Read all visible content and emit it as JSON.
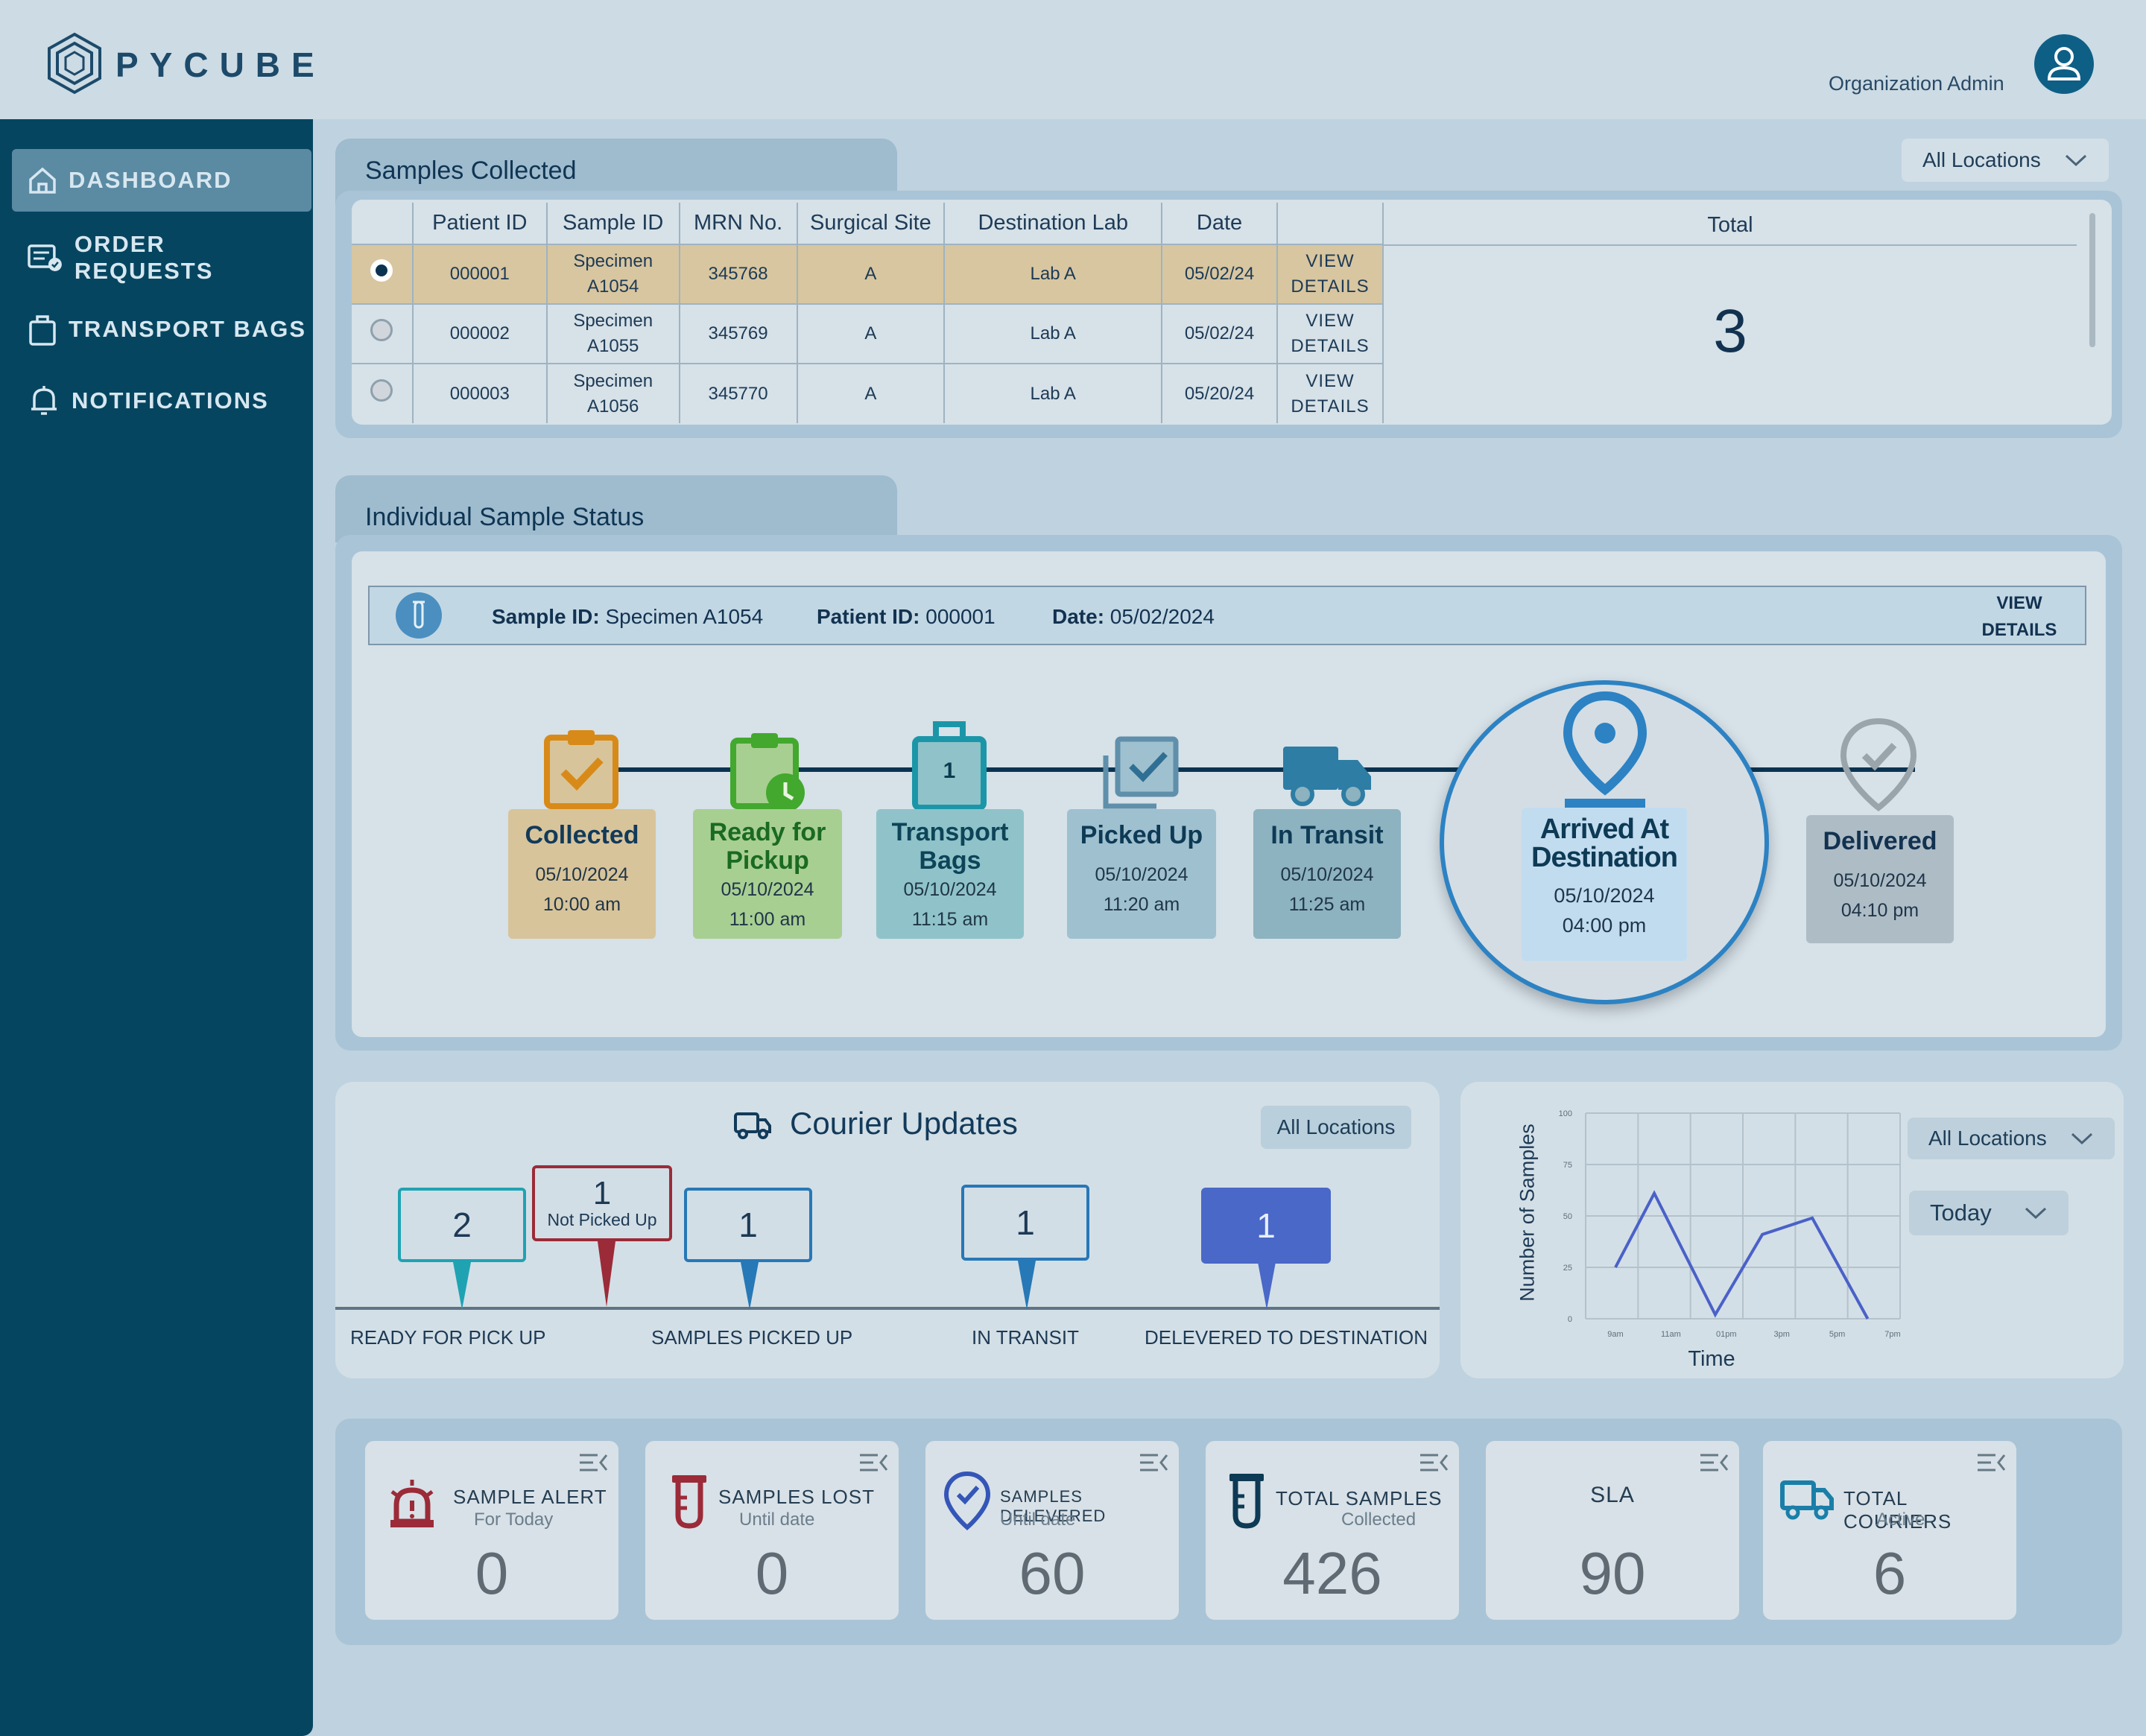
{
  "app": {
    "logo": "PYCUBE",
    "user_role": "Organization Admin"
  },
  "sidebar": {
    "items": [
      {
        "label": "DASHBOARD",
        "icon": "home-icon",
        "active": true
      },
      {
        "label": "ORDER REQUESTS",
        "icon": "order-list-icon",
        "active": false
      },
      {
        "label": "TRANSPORT BAGS",
        "icon": "bag-icon",
        "active": false
      },
      {
        "label": "NOTIFICATIONS",
        "icon": "bell-icon",
        "active": false
      }
    ]
  },
  "samples_collected": {
    "title": "Samples Collected",
    "location_filter": "All Locations",
    "columns": [
      "Patient ID",
      "Sample ID",
      "MRN No.",
      "Surgical Site",
      "Destination Lab",
      "Date"
    ],
    "total_label": "Total",
    "total_value": "3",
    "rows": [
      {
        "patient_id": "000001",
        "sample_line1": "Specimen",
        "sample_line2": "A1054",
        "mrn": "345768",
        "site": "A",
        "lab": "Lab A",
        "date": "05/02/24",
        "action1": "VIEW",
        "action2": "DETAILS",
        "selected": true
      },
      {
        "patient_id": "000002",
        "sample_line1": "Specimen",
        "sample_line2": "A1055",
        "mrn": "345769",
        "site": "A",
        "lab": "Lab A",
        "date": "05/02/24",
        "action1": "VIEW",
        "action2": "DETAILS",
        "selected": false
      },
      {
        "patient_id": "000003",
        "sample_line1": "Specimen",
        "sample_line2": "A1056",
        "mrn": "345770",
        "site": "A",
        "lab": "Lab A",
        "date": "05/20/24",
        "action1": "VIEW",
        "action2": "DETAILS",
        "selected": false
      }
    ]
  },
  "status": {
    "title": "Individual Sample Status",
    "sample_id_label": "Sample ID:",
    "sample_id": "Specimen A1054",
    "patient_id_label": "Patient ID:",
    "patient_id": "000001",
    "date_label": "Date:",
    "date": "05/02/2024",
    "view1": "VIEW",
    "view2": "DETAILS",
    "steps": [
      {
        "l1": "Collected",
        "l2": "",
        "date": "05/10/2024",
        "time": "10:00 am",
        "color": "#d8c49a",
        "icon": "clipboard-check-icon"
      },
      {
        "l1": "Ready for",
        "l2": "Pickup",
        "date": "05/10/2024",
        "time": "11:00 am",
        "color": "#a8cf92",
        "icon": "clipboard-clock-icon"
      },
      {
        "l1": "Transport",
        "l2": "Bags",
        "date": "05/10/2024",
        "time": "11:15 am",
        "color": "#8fc3c9",
        "icon": "bag-icon"
      },
      {
        "l1": "Picked Up",
        "l2": "",
        "date": "05/10/2024",
        "time": "11:20 am",
        "color": "#9fc0cf",
        "icon": "checkbox-stack-icon"
      },
      {
        "l1": "In Transit",
        "l2": "",
        "date": "05/10/2024",
        "time": "11:25 am",
        "color": "#8db2c0",
        "icon": "truck-icon"
      },
      {
        "l1": "Arrived At",
        "l2": "Destination",
        "date": "05/10/2024",
        "time": "04:00 pm",
        "color": "#c2dcef",
        "icon": "location-pin-icon"
      },
      {
        "l1": "Delivered",
        "l2": "",
        "date": "05/10/2024",
        "time": "04:10 pm",
        "color": "#aebcc6",
        "icon": "check-pin-icon"
      }
    ],
    "bag_count": "1"
  },
  "courier": {
    "title": "Courier Updates",
    "location_filter": "All Locations",
    "flags": [
      {
        "value": "2",
        "sub": ""
      },
      {
        "value": "1",
        "sub": "Not Picked Up"
      },
      {
        "value": "1",
        "sub": ""
      },
      {
        "value": "1",
        "sub": ""
      },
      {
        "value": "1",
        "sub": ""
      }
    ],
    "labels": [
      "READY FOR PICK UP",
      "SAMPLES PICKED UP",
      "IN TRANSIT",
      "DELEVERED TO DESTINATION"
    ]
  },
  "chart_filters": {
    "location": "All Locations",
    "period": "Today"
  },
  "chart_data": {
    "type": "line",
    "ylabel": "Number of Samples",
    "xlabel": "Time",
    "x": [
      "9am",
      "11am",
      "01pm",
      "3pm",
      "5pm",
      "7pm"
    ],
    "yticks": [
      "100",
      "75",
      "50",
      "25",
      "0"
    ],
    "ylim": [
      0,
      100
    ],
    "series": [
      {
        "points": [
          [
            0,
            25
          ],
          [
            0.7,
            61
          ],
          [
            1.8,
            2
          ],
          [
            2.65,
            41
          ],
          [
            3.55,
            49
          ],
          [
            4.55,
            0
          ]
        ],
        "color": "#4a61c8"
      }
    ]
  },
  "cards": [
    {
      "title": "SAMPLE ALERT",
      "sub": "For Today",
      "value": "0",
      "icon": "alarm-icon",
      "color": "#9b2b38"
    },
    {
      "title": "SAMPLES LOST",
      "sub": "Until date",
      "value": "0",
      "icon": "test-tube-icon",
      "color": "#9b2b38"
    },
    {
      "title": "SAMPLES DELEVERED",
      "sub": "Until date",
      "value": "60",
      "icon": "check-pin-icon",
      "color": "#3456b8"
    },
    {
      "title": "TOTAL SAMPLES",
      "sub": "Collected",
      "value": "426",
      "icon": "test-tube-icon",
      "color": "#0d3a55"
    },
    {
      "title": "SLA",
      "sub": "",
      "value": "90",
      "icon": "",
      "color": ""
    },
    {
      "title": "TOTAL COURIERS",
      "sub": "Active",
      "value": "6",
      "icon": "truck-icon",
      "color": "#1a7fa8"
    }
  ]
}
